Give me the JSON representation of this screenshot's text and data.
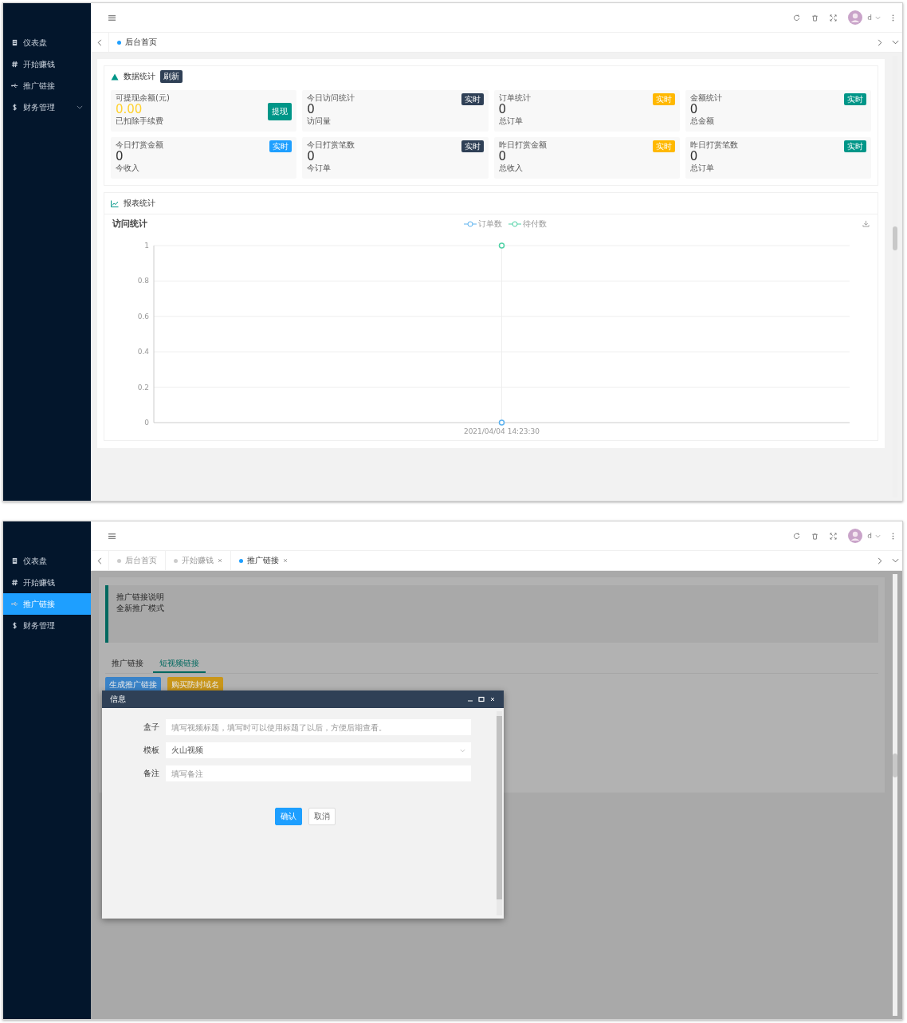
{
  "screens": [
    {
      "kind": "dashboard",
      "sidebar": {
        "items": [
          {
            "label": "仪表盘",
            "selected": false,
            "expandable": false
          },
          {
            "label": "开始赚钱",
            "selected": false,
            "expandable": false
          },
          {
            "label": "推广链接",
            "selected": false,
            "expandable": false
          },
          {
            "label": "财务管理",
            "selected": false,
            "expandable": true
          }
        ]
      },
      "header": {
        "user": "d"
      },
      "tabs": [
        {
          "label": "后台首页",
          "selected": true,
          "closable": false
        }
      ],
      "stats_panel": {
        "title": "数据统计",
        "badge": "刷新",
        "cards": [
          {
            "kind": "balance",
            "label": "可提现余额(元)",
            "value": "0.00",
            "note": "已扣除手续费",
            "button": "提现"
          },
          {
            "kind": "stat",
            "label": "今日访问统计",
            "value": "0",
            "note": "访问量",
            "badge": "实时",
            "color": "#2f4056"
          },
          {
            "kind": "stat",
            "label": "订单统计",
            "value": "0",
            "note": "总订单",
            "badge": "实时",
            "color": "#ffb800"
          },
          {
            "kind": "stat",
            "label": "金额统计",
            "value": "0",
            "note": "总金额",
            "badge": "实时",
            "color": "#009688"
          },
          {
            "kind": "stat",
            "label": "今日打赏金额",
            "value": "0",
            "note": "今收入",
            "badge": "实时",
            "color": "#1e9fff"
          },
          {
            "kind": "stat",
            "label": "今日打赏笔数",
            "value": "0",
            "note": "今订单",
            "badge": "实时",
            "color": "#2f4056"
          },
          {
            "kind": "stat",
            "label": "昨日打赏金额",
            "value": "0",
            "note": "总收入",
            "badge": "实时",
            "color": "#ffb800"
          },
          {
            "kind": "stat",
            "label": "昨日打赏笔数",
            "value": "0",
            "note": "总订单",
            "badge": "实时",
            "color": "#009688"
          }
        ]
      },
      "report_panel": {
        "title": "报表统计",
        "chart_data": {
          "type": "line",
          "title": "访问统计",
          "categories": [
            "2021/04/04 14:23:30"
          ],
          "series": [
            {
              "name": "订单数",
              "color": "#5ab1ef",
              "values": [
                0
              ],
              "marker": "circle"
            },
            {
              "name": "待付数",
              "color": "#4fd1a5",
              "values": [
                1
              ],
              "marker": "circle"
            }
          ],
          "ylim": [
            0,
            1
          ],
          "yticks": [
            0,
            0.2,
            0.4,
            0.6,
            0.8,
            1
          ],
          "grid": true,
          "legend": true
        }
      }
    },
    {
      "kind": "promo",
      "sidebar": {
        "items": [
          {
            "label": "仪表盘",
            "selected": false,
            "expandable": false
          },
          {
            "label": "开始赚钱",
            "selected": false,
            "expandable": false
          },
          {
            "label": "推广链接",
            "selected": true,
            "expandable": false
          },
          {
            "label": "财务管理",
            "selected": false,
            "expandable": false
          }
        ]
      },
      "header": {
        "user": "d"
      },
      "tabs": [
        {
          "label": "后台首页",
          "selected": false,
          "closable": false
        },
        {
          "label": "开始赚钱",
          "selected": false,
          "closable": true
        },
        {
          "label": "推广链接",
          "selected": true,
          "closable": true
        }
      ],
      "notice": {
        "lines": [
          "推广链接说明",
          "全新推广模式"
        ]
      },
      "subtabs": [
        {
          "label": "推广链接",
          "selected": false
        },
        {
          "label": "短视频链接",
          "selected": true
        }
      ],
      "buttons": [
        {
          "label": "生成推广链接",
          "color": "#3a83c8"
        },
        {
          "label": "购买防封域名",
          "color": "#c9961a"
        }
      ],
      "dialog": {
        "title": "信息",
        "fields": [
          {
            "kind": "text",
            "label": "盒子",
            "placeholder": "填写视频标题，填写时可以使用标题了以后，方便后期查看。"
          },
          {
            "kind": "select",
            "label": "模板",
            "value": "火山视频"
          },
          {
            "kind": "text",
            "label": "备注",
            "placeholder": "填写备注"
          }
        ],
        "buttons": [
          {
            "label": "确认",
            "primary": true
          },
          {
            "label": "取消",
            "primary": false
          }
        ]
      }
    }
  ]
}
